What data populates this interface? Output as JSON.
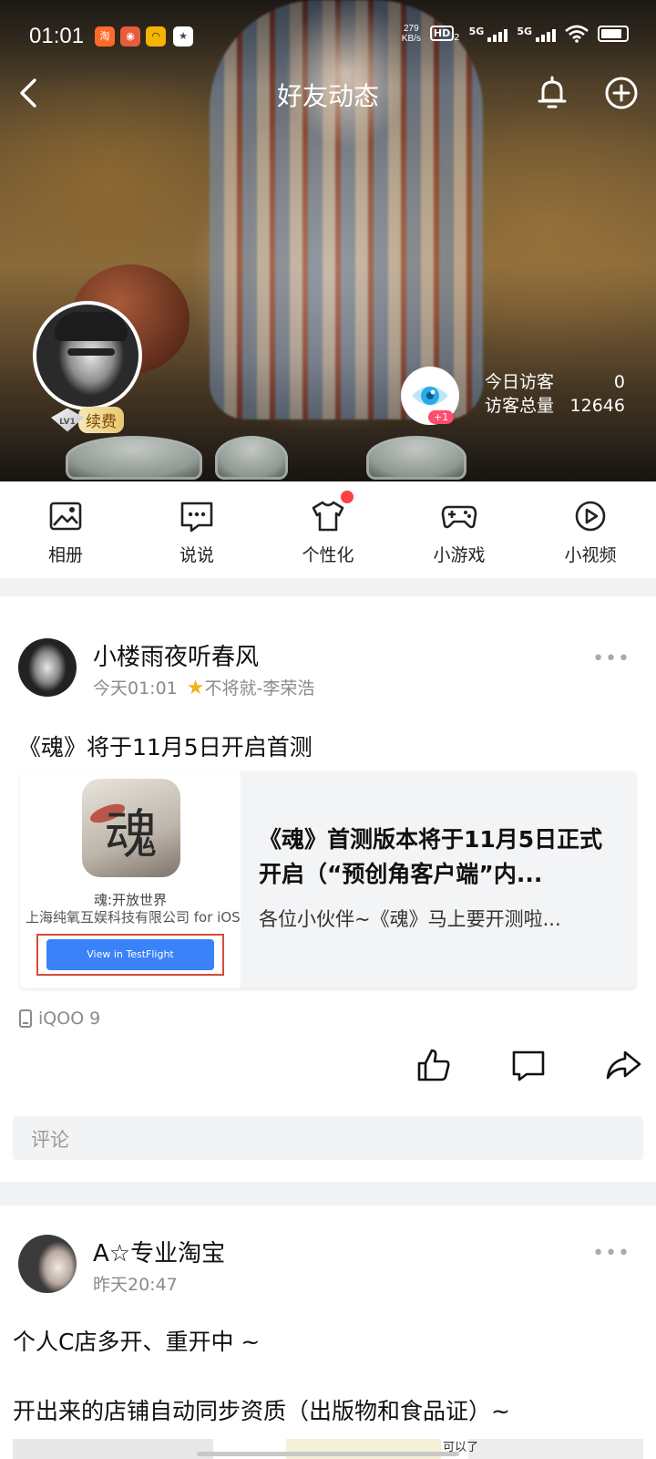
{
  "status_bar": {
    "time": "01:01",
    "app_icons": [
      "taobao-icon",
      "app2-icon",
      "app3-icon",
      "notification-icon"
    ],
    "speed_value": "279",
    "speed_unit": "KB/s",
    "hd_label": "HD",
    "hd_sub": "2",
    "signal1_label": "5G",
    "signal2_label": "5G",
    "battery_level": 0.95
  },
  "header": {
    "title": "好友动态",
    "icons": [
      "back-icon",
      "bell-icon",
      "add-icon"
    ]
  },
  "profile": {
    "level": "LV1",
    "renew_label": "续费",
    "visitor_badge": "+1",
    "today_visitors_label": "今日访客",
    "today_visitors_value": "0",
    "total_visitors_label": "访客总量",
    "total_visitors_value": "12646"
  },
  "tools": [
    {
      "label": "相册",
      "icon": "album-icon"
    },
    {
      "label": "说说",
      "icon": "chat-icon"
    },
    {
      "label": "个性化",
      "icon": "shirt-icon",
      "has_dot": true
    },
    {
      "label": "小游戏",
      "icon": "gamepad-icon"
    },
    {
      "label": "小视频",
      "icon": "video-icon"
    }
  ],
  "post1": {
    "author": "小楼雨夜听春风",
    "time": "今天01:01",
    "tag": "不将就-李荣浩",
    "text": "《魂》将于11月5日开启首测",
    "share": {
      "game_glyph": "魂",
      "thumb_title": "魂:开放世界",
      "thumb_company": "上海纯氧互娱科技有限公司 for iOS",
      "testflight_label": "View in TestFlight",
      "title": "《魂》首测版本将于11月5日正式开启（“预创角客户端”内...",
      "desc": "各位小伙伴~《魂》马上要开测啦..."
    },
    "device": "iQOO 9",
    "comment_placeholder": "评论"
  },
  "post2": {
    "author": "A☆专业淘宝",
    "time": "昨天20:47",
    "line1": "个人C店多开、重开中 ~",
    "line2": "开出来的店铺自动同步资质（出版物和食品证）~",
    "image_caption": "可以了"
  },
  "colors": {
    "accent_red": "#ff4040",
    "badge_pink": "#ff4d6d",
    "eye_blue": "#2aa9e8",
    "testflight_blue": "#3a82f7"
  }
}
